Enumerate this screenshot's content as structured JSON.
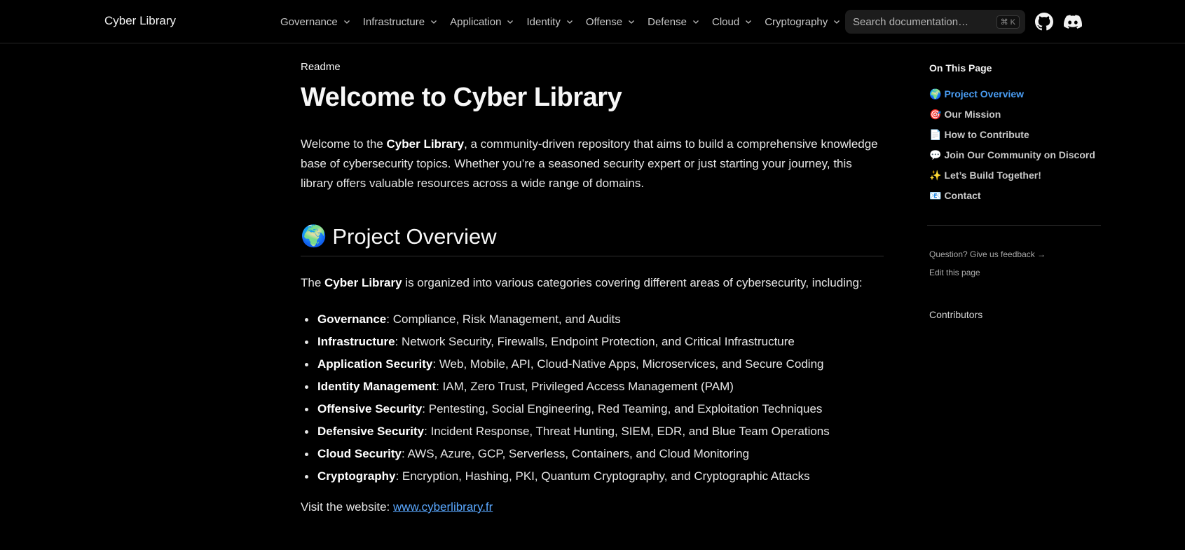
{
  "brand": "Cyber Library",
  "nav": [
    {
      "label": "Governance"
    },
    {
      "label": "Infrastructure"
    },
    {
      "label": "Application"
    },
    {
      "label": "Identity"
    },
    {
      "label": "Offense"
    },
    {
      "label": "Defense"
    },
    {
      "label": "Cloud"
    },
    {
      "label": "Cryptography"
    }
  ],
  "search": {
    "placeholder": "Search documentation…",
    "shortcut": "⌘ K"
  },
  "icons": {
    "github": "github-icon",
    "discord": "discord-icon"
  },
  "page": {
    "breadcrumb": "Readme",
    "title": "Welcome to Cyber Library",
    "intro": {
      "pre": "Welcome to the ",
      "bold": "Cyber Library",
      "post": ", a community-driven repository that aims to build a comprehensive knowledge base of cybersecurity topics. Whether you’re a seasoned security expert or just starting your journey, this library offers valuable resources across a wide range of domains."
    },
    "overview": {
      "emoji": "🌍",
      "heading": "Project Overview",
      "lead_pre": "The ",
      "lead_bold": "Cyber Library",
      "lead_post": " is organized into various categories covering different areas of cybersecurity, including:",
      "categories": [
        {
          "name": "Governance",
          "desc": ": Compliance, Risk Management, and Audits"
        },
        {
          "name": "Infrastructure",
          "desc": ": Network Security, Firewalls, Endpoint Protection, and Critical Infrastructure"
        },
        {
          "name": "Application Security",
          "desc": ": Web, Mobile, API, Cloud-Native Apps, Microservices, and Secure Coding"
        },
        {
          "name": "Identity Management",
          "desc": ": IAM, Zero Trust, Privileged Access Management (PAM)"
        },
        {
          "name": "Offensive Security",
          "desc": ": Pentesting, Social Engineering, Red Teaming, and Exploitation Techniques"
        },
        {
          "name": "Defensive Security",
          "desc": ": Incident Response, Threat Hunting, SIEM, EDR, and Blue Team Operations"
        },
        {
          "name": "Cloud Security",
          "desc": ": AWS, Azure, GCP, Serverless, Containers, and Cloud Monitoring"
        },
        {
          "name": "Cryptography",
          "desc": ": Encryption, Hashing, PKI, Quantum Cryptography, and Cryptographic Attacks"
        }
      ],
      "visit_label": "Visit the website: ",
      "visit_link": "www.cyberlibrary.fr"
    }
  },
  "toc": {
    "title": "On This Page",
    "items": [
      {
        "emoji": "🌍",
        "label": "Project Overview",
        "active": true
      },
      {
        "emoji": "🎯",
        "label": "Our Mission"
      },
      {
        "emoji": "📄",
        "label": "How to Contribute"
      },
      {
        "emoji": "💬",
        "label": "Join Our Community on Discord"
      },
      {
        "emoji": "✨",
        "label": "Let’s Build Together!"
      },
      {
        "emoji": "📧",
        "label": "Contact"
      }
    ],
    "feedback": "Question? Give us feedback →",
    "edit": "Edit this page",
    "contributors": "Contributors"
  },
  "colors": {
    "background": "#000000",
    "link": "#5aa8ff",
    "toc_active": "#4a9df3"
  }
}
